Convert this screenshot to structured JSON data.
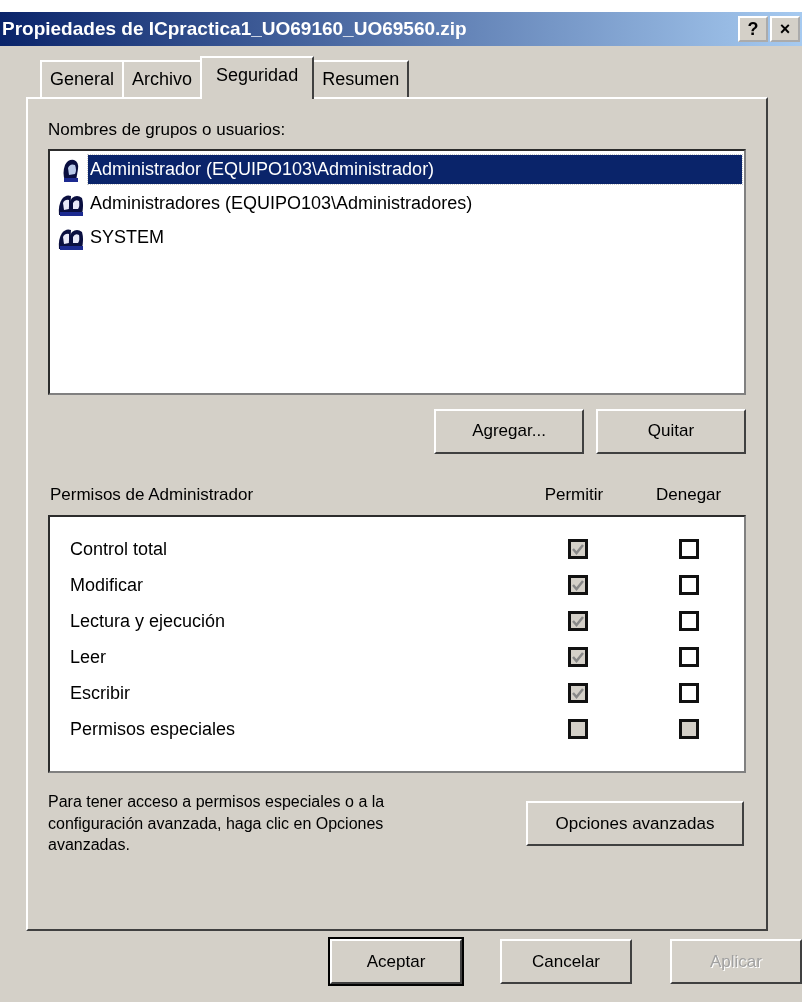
{
  "window": {
    "title": "Propiedades de ICpractica1_UO69160_UO69560.zip",
    "title_buttons": [
      "?",
      "×"
    ]
  },
  "tabs": [
    {
      "label": "General",
      "selected": false
    },
    {
      "label": "Archivo",
      "selected": false
    },
    {
      "label": "Seguridad",
      "selected": true
    },
    {
      "label": "Resumen",
      "selected": false
    }
  ],
  "users": {
    "label": "Nombres de grupos o usuarios:",
    "items": [
      {
        "name": "Administrador (EQUIPO103\\Administrador)",
        "kind": "user",
        "selected": true
      },
      {
        "name": "Administradores (EQUIPO103\\Administradores)",
        "kind": "group",
        "selected": false
      },
      {
        "name": "SYSTEM",
        "kind": "group",
        "selected": false
      }
    ]
  },
  "user_buttons": [
    "Agregar...",
    "Quitar"
  ],
  "permissions": {
    "label": "Permisos de Administrador",
    "columns": [
      "Permitir",
      "Denegar"
    ],
    "rows": [
      {
        "name": "Control total",
        "allow": {
          "checked": true,
          "disabled": true
        },
        "deny": {
          "checked": false,
          "disabled": false
        }
      },
      {
        "name": "Modificar",
        "allow": {
          "checked": true,
          "disabled": true
        },
        "deny": {
          "checked": false,
          "disabled": false
        }
      },
      {
        "name": "Lectura y ejecución",
        "allow": {
          "checked": true,
          "disabled": true
        },
        "deny": {
          "checked": false,
          "disabled": false
        }
      },
      {
        "name": "Leer",
        "allow": {
          "checked": true,
          "disabled": true
        },
        "deny": {
          "checked": false,
          "disabled": false
        }
      },
      {
        "name": "Escribir",
        "allow": {
          "checked": true,
          "disabled": true
        },
        "deny": {
          "checked": false,
          "disabled": false
        }
      },
      {
        "name": "Permisos especiales",
        "allow": {
          "checked": false,
          "disabled": true
        },
        "deny": {
          "checked": false,
          "disabled": true
        }
      }
    ]
  },
  "advanced": {
    "text": "Para tener acceso a permisos especiales o a la configuración avanzada, haga clic en Opciones avanzadas.",
    "button": "Opciones avanzadas"
  },
  "buttons": [
    {
      "label": "Aceptar",
      "default": true,
      "disabled": false
    },
    {
      "label": "Cancelar",
      "default": false,
      "disabled": false
    },
    {
      "label": "Aplicar",
      "default": false,
      "disabled": true
    }
  ]
}
